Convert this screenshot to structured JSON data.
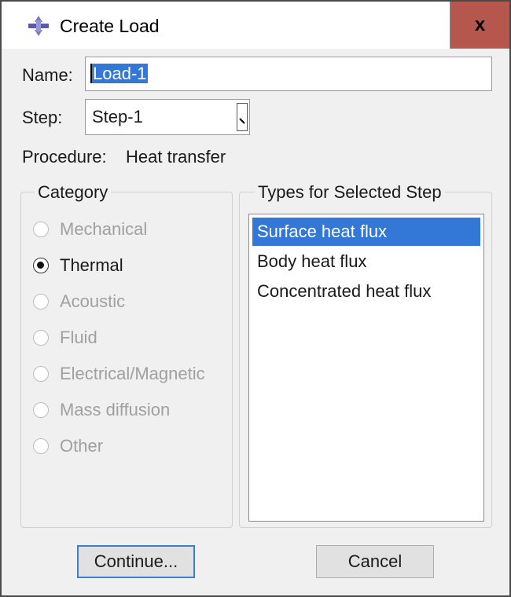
{
  "window": {
    "title": "Create Load",
    "close_label": "x"
  },
  "form": {
    "name_label": "Name:",
    "name_value": "Load-1",
    "step_label": "Step:",
    "step_value": "Step-1",
    "procedure_label": "Procedure:",
    "procedure_value": "Heat transfer"
  },
  "category": {
    "legend": "Category",
    "items": [
      {
        "label": "Mechanical",
        "checked": false,
        "enabled": false
      },
      {
        "label": "Thermal",
        "checked": true,
        "enabled": true
      },
      {
        "label": "Acoustic",
        "checked": false,
        "enabled": false
      },
      {
        "label": "Fluid",
        "checked": false,
        "enabled": false
      },
      {
        "label": "Electrical/Magnetic",
        "checked": false,
        "enabled": false
      },
      {
        "label": "Mass diffusion",
        "checked": false,
        "enabled": false
      },
      {
        "label": "Other",
        "checked": false,
        "enabled": false
      }
    ]
  },
  "types": {
    "legend": "Types for Selected Step",
    "items": [
      {
        "label": "Surface heat flux",
        "selected": true
      },
      {
        "label": "Body heat flux",
        "selected": false
      },
      {
        "label": "Concentrated heat flux",
        "selected": false
      }
    ]
  },
  "buttons": {
    "continue": "Continue...",
    "cancel": "Cancel"
  },
  "colors": {
    "selection": "#3378d6",
    "close_button": "#b5574d",
    "default_button_border": "#3c7fd1"
  }
}
